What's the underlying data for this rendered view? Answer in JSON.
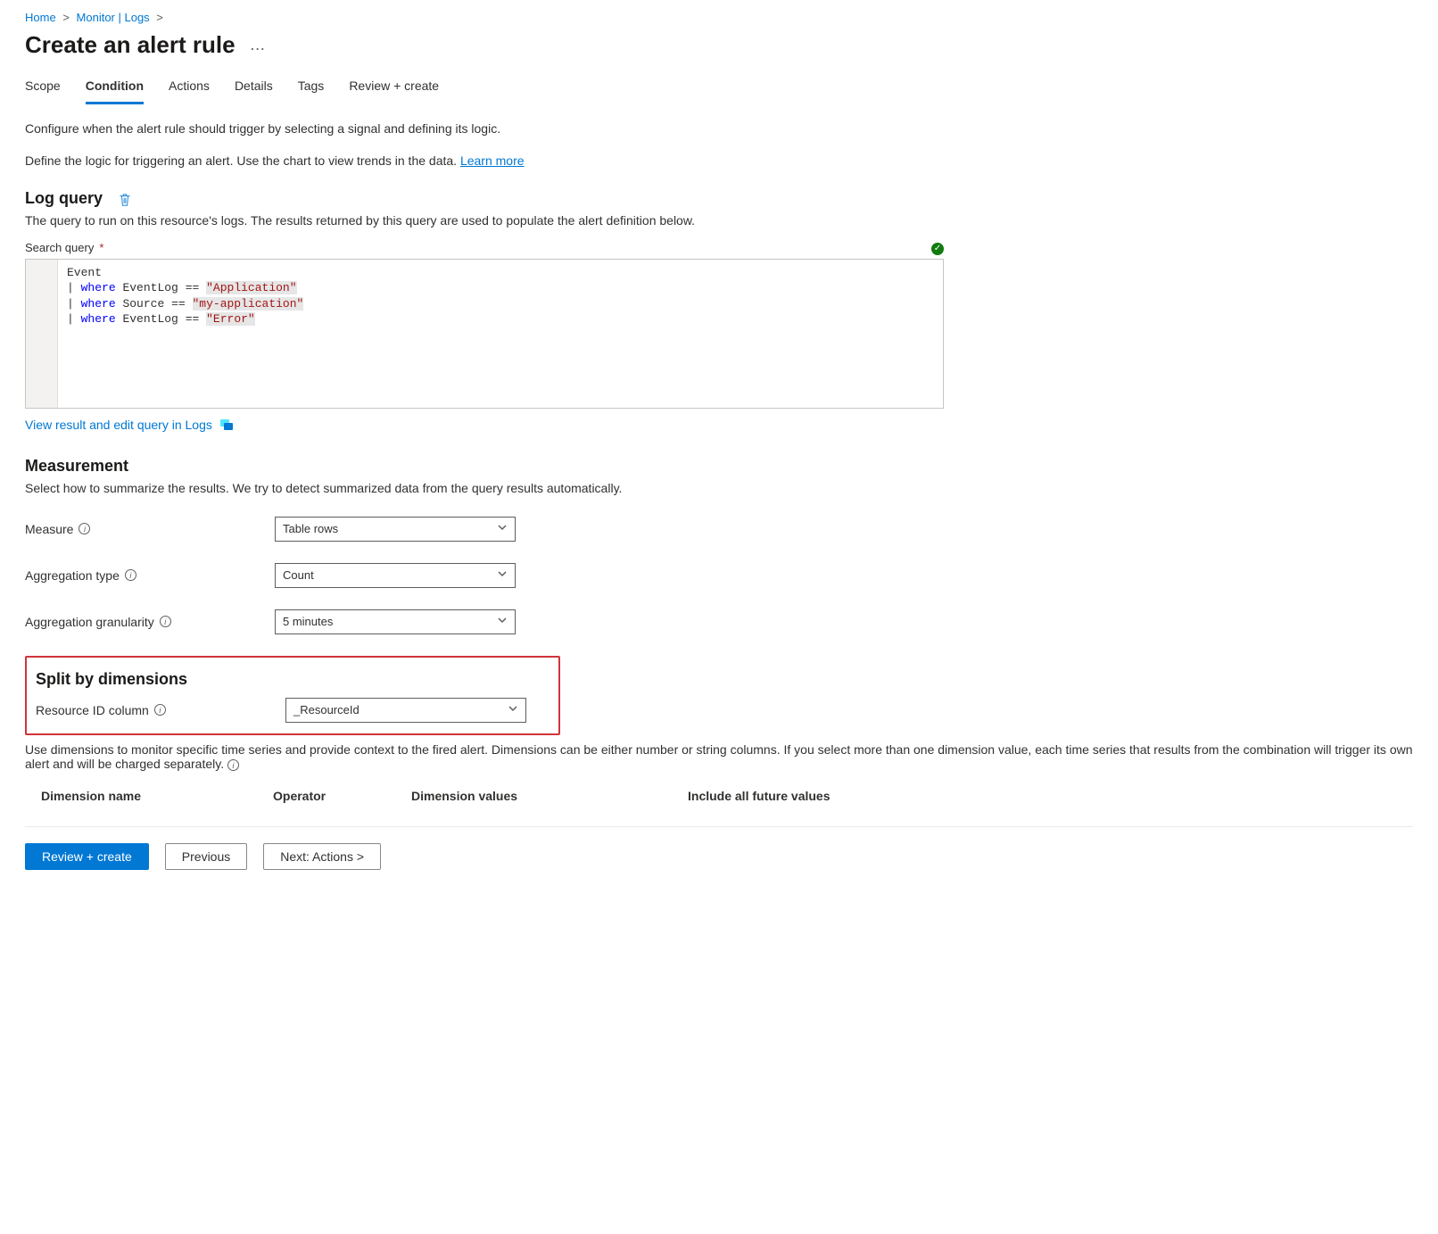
{
  "breadcrumb": {
    "items": [
      "Home",
      "Monitor | Logs"
    ]
  },
  "page_title": "Create an alert rule",
  "tabs": [
    "Scope",
    "Condition",
    "Actions",
    "Details",
    "Tags",
    "Review + create"
  ],
  "active_tab_index": 1,
  "intro_paragraphs": {
    "p1": "Configure when the alert rule should trigger by selecting a signal and defining its logic.",
    "p2_prefix": "Define the logic for triggering an alert. Use the chart to view trends in the data. ",
    "learn_more_label": "Learn more"
  },
  "log_query": {
    "heading": "Log query",
    "description": "The query to run on this resource's logs. The results returned by this query are used to populate the alert definition below.",
    "search_query_label": "Search query",
    "code_lines": [
      {
        "plain": "Event"
      },
      {
        "pipe": "|",
        "kw": "where",
        "ident": "EventLog",
        "op": "==",
        "str": "\"Application\""
      },
      {
        "pipe": "|",
        "kw": "where",
        "ident": "Source",
        "op": "==",
        "str": "\"my-application\""
      },
      {
        "pipe": "|",
        "kw": "where",
        "ident": "EventLog",
        "op": "==",
        "str": "\"Error\""
      }
    ],
    "view_in_logs_label": "View result and edit query in Logs"
  },
  "measurement": {
    "heading": "Measurement",
    "description": "Select how to summarize the results. We try to detect summarized data from the query results automatically.",
    "fields": {
      "measure": {
        "label": "Measure",
        "value": "Table rows"
      },
      "aggregation_type": {
        "label": "Aggregation type",
        "value": "Count"
      },
      "aggregation_granularity": {
        "label": "Aggregation granularity",
        "value": "5 minutes"
      }
    }
  },
  "split": {
    "heading": "Split by dimensions",
    "resource_id_label": "Resource ID column",
    "resource_id_value": "_ResourceId",
    "description": "Use dimensions to monitor specific time series and provide context to the fired alert. Dimensions can be either number or string columns. If you select more than one dimension value, each time series that results from the combination will trigger its own alert and will be charged separately.",
    "columns": [
      "Dimension name",
      "Operator",
      "Dimension values",
      "Include all future values"
    ]
  },
  "footer": {
    "primary": "Review + create",
    "previous": "Previous",
    "next": "Next: Actions >"
  }
}
